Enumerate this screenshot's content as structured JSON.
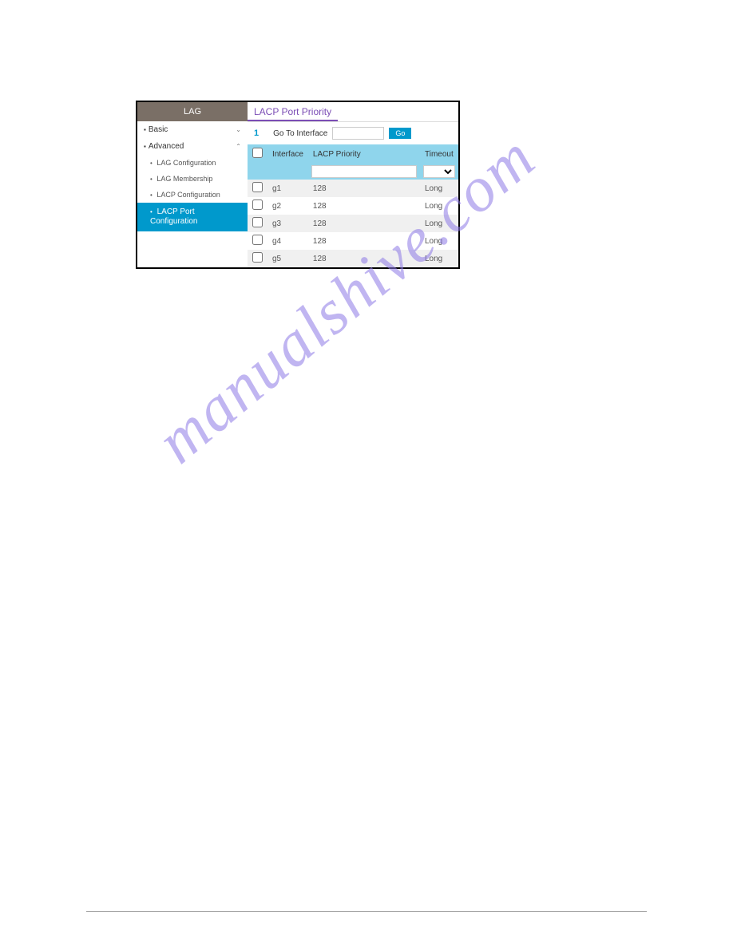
{
  "sidebar": {
    "header": "LAG",
    "items": [
      {
        "label": "Basic",
        "type": "parent",
        "expanded": false
      },
      {
        "label": "Advanced",
        "type": "parent",
        "expanded": true
      },
      {
        "label": "LAG Configuration",
        "type": "sub"
      },
      {
        "label": "LAG Membership",
        "type": "sub"
      },
      {
        "label": "LACP Configuration",
        "type": "sub"
      },
      {
        "label": "LACP Port Configuration",
        "type": "sub",
        "active": true
      }
    ]
  },
  "main": {
    "title": "LACP Port Priority",
    "goto": {
      "number": "1",
      "label": "Go To Interface",
      "button": "Go"
    },
    "table": {
      "headers": {
        "interface": "Interface",
        "priority": "LACP Priority",
        "timeout": "Timeout"
      },
      "rows": [
        {
          "interface": "g1",
          "priority": "128",
          "timeout": "Long"
        },
        {
          "interface": "g2",
          "priority": "128",
          "timeout": "Long"
        },
        {
          "interface": "g3",
          "priority": "128",
          "timeout": "Long"
        },
        {
          "interface": "g4",
          "priority": "128",
          "timeout": "Long"
        },
        {
          "interface": "g5",
          "priority": "128",
          "timeout": "Long"
        }
      ]
    }
  },
  "watermark": "manualshive.com"
}
